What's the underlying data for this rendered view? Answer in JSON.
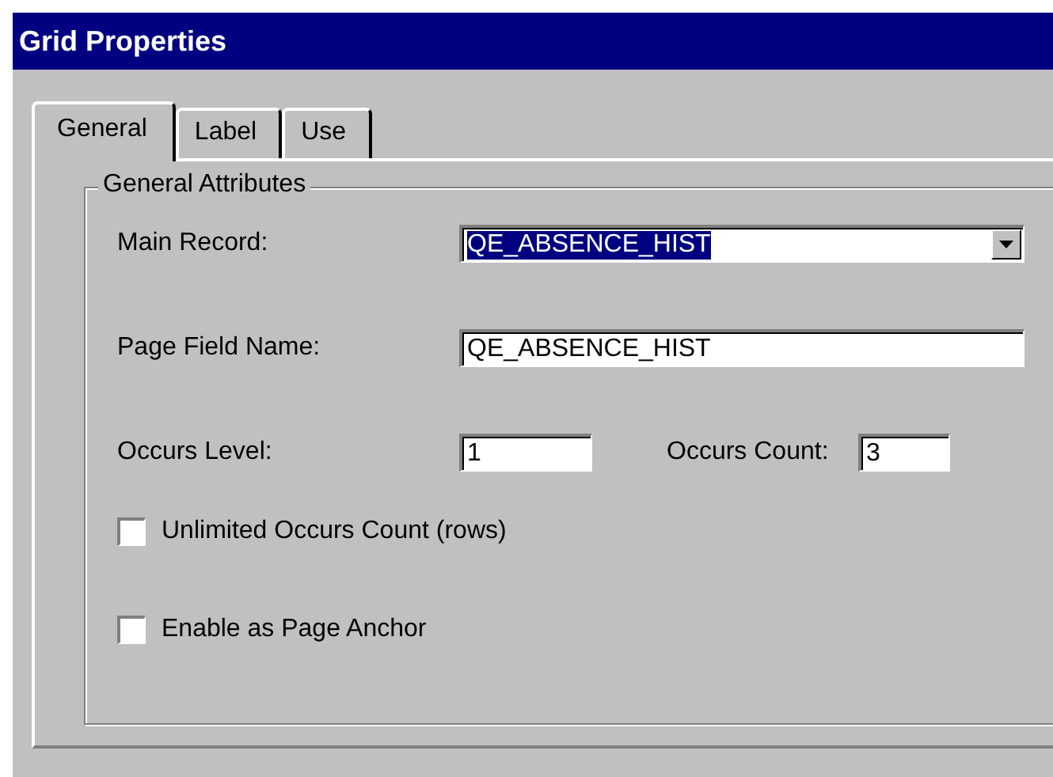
{
  "window": {
    "title": "Grid Properties"
  },
  "tabs": [
    {
      "label": "General",
      "selected": true
    },
    {
      "label": "Label",
      "selected": false
    },
    {
      "label": "Use",
      "selected": false
    }
  ],
  "group": {
    "title": "General Attributes"
  },
  "main_record": {
    "label": "Main Record:",
    "value": "QE_ABSENCE_HIST",
    "text_selected": true
  },
  "page_field_name": {
    "label": "Page Field Name:",
    "value": "QE_ABSENCE_HIST"
  },
  "occurs_level": {
    "label": "Occurs Level:",
    "value": "1"
  },
  "occurs_count": {
    "label": "Occurs Count:",
    "value": "3"
  },
  "checkboxes": [
    {
      "label": "Unlimited Occurs Count (rows)",
      "checked": false
    },
    {
      "label": "Enable as Page Anchor",
      "checked": false
    }
  ]
}
